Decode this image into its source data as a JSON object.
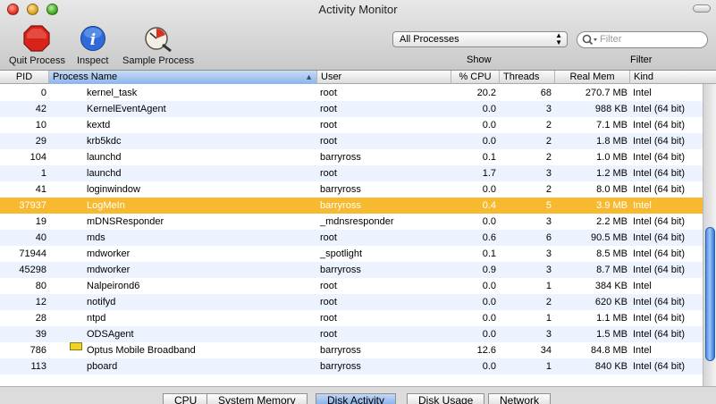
{
  "window": {
    "title": "Activity Monitor"
  },
  "toolbar": {
    "quit_label": "Quit Process",
    "inspect_label": "Inspect",
    "sample_label": "Sample Process",
    "show_label": "Show",
    "filter_label": "Filter",
    "show_select_value": "All Processes",
    "filter_placeholder": "Filter"
  },
  "columns": {
    "pid": "PID",
    "name": "Process Name",
    "user": "User",
    "cpu": "% CPU",
    "threads": "Threads",
    "real_mem": "Real Mem",
    "kind": "Kind"
  },
  "rows": [
    {
      "pid": "0",
      "name": "kernel_task",
      "user": "root",
      "cpu": "20.2",
      "threads": "68",
      "mem": "270.7 MB",
      "kind": "Intel"
    },
    {
      "pid": "42",
      "name": "KernelEventAgent",
      "user": "root",
      "cpu": "0.0",
      "threads": "3",
      "mem": "988 KB",
      "kind": "Intel (64 bit)"
    },
    {
      "pid": "10",
      "name": "kextd",
      "user": "root",
      "cpu": "0.0",
      "threads": "2",
      "mem": "7.1 MB",
      "kind": "Intel (64 bit)"
    },
    {
      "pid": "29",
      "name": "krb5kdc",
      "user": "root",
      "cpu": "0.0",
      "threads": "2",
      "mem": "1.8 MB",
      "kind": "Intel (64 bit)"
    },
    {
      "pid": "104",
      "name": "launchd",
      "user": "barryross",
      "cpu": "0.1",
      "threads": "2",
      "mem": "1.0 MB",
      "kind": "Intel (64 bit)"
    },
    {
      "pid": "1",
      "name": "launchd",
      "user": "root",
      "cpu": "1.7",
      "threads": "3",
      "mem": "1.2 MB",
      "kind": "Intel (64 bit)"
    },
    {
      "pid": "41",
      "name": "loginwindow",
      "user": "barryross",
      "cpu": "0.0",
      "threads": "2",
      "mem": "8.0 MB",
      "kind": "Intel (64 bit)"
    },
    {
      "pid": "37937",
      "name": "LogMeIn",
      "user": "barryross",
      "cpu": "0.4",
      "threads": "5",
      "mem": "3.9 MB",
      "kind": "Intel"
    },
    {
      "pid": "19",
      "name": "mDNSResponder",
      "user": "_mdnsresponder",
      "cpu": "0.0",
      "threads": "3",
      "mem": "2.2 MB",
      "kind": "Intel (64 bit)"
    },
    {
      "pid": "40",
      "name": "mds",
      "user": "root",
      "cpu": "0.6",
      "threads": "6",
      "mem": "90.5 MB",
      "kind": "Intel (64 bit)"
    },
    {
      "pid": "71944",
      "name": "mdworker",
      "user": "_spotlight",
      "cpu": "0.1",
      "threads": "3",
      "mem": "8.5 MB",
      "kind": "Intel (64 bit)"
    },
    {
      "pid": "45298",
      "name": "mdworker",
      "user": "barryross",
      "cpu": "0.9",
      "threads": "3",
      "mem": "8.7 MB",
      "kind": "Intel (64 bit)"
    },
    {
      "pid": "80",
      "name": "Nalpeirond6",
      "user": "root",
      "cpu": "0.0",
      "threads": "1",
      "mem": "384 KB",
      "kind": "Intel"
    },
    {
      "pid": "12",
      "name": "notifyd",
      "user": "root",
      "cpu": "0.0",
      "threads": "2",
      "mem": "620 KB",
      "kind": "Intel (64 bit)"
    },
    {
      "pid": "28",
      "name": "ntpd",
      "user": "root",
      "cpu": "0.0",
      "threads": "1",
      "mem": "1.1 MB",
      "kind": "Intel (64 bit)"
    },
    {
      "pid": "39",
      "name": "ODSAgent",
      "user": "root",
      "cpu": "0.0",
      "threads": "3",
      "mem": "1.5 MB",
      "kind": "Intel (64 bit)"
    },
    {
      "pid": "786",
      "name": "Optus Mobile Broadband",
      "user": "barryross",
      "cpu": "12.6",
      "threads": "34",
      "mem": "84.8 MB",
      "kind": "Intel"
    },
    {
      "pid": "113",
      "name": "pboard",
      "user": "barryross",
      "cpu": "0.0",
      "threads": "1",
      "mem": "840 KB",
      "kind": "Intel (64 bit)"
    }
  ],
  "tabs": [
    "CPU",
    "System Memory",
    "Disk Activity",
    "Disk Usage",
    "Network"
  ],
  "active_tab": "Disk Activity",
  "selected_pid": "37937",
  "colors": {
    "selection": "#f7b92f",
    "alt_row": "#edf3fe",
    "sorted_header": "#8bb4e9"
  },
  "icons": [
    "stop-sign-icon",
    "info-icon",
    "sample-process-icon",
    "search-icon",
    "app-icon"
  ]
}
